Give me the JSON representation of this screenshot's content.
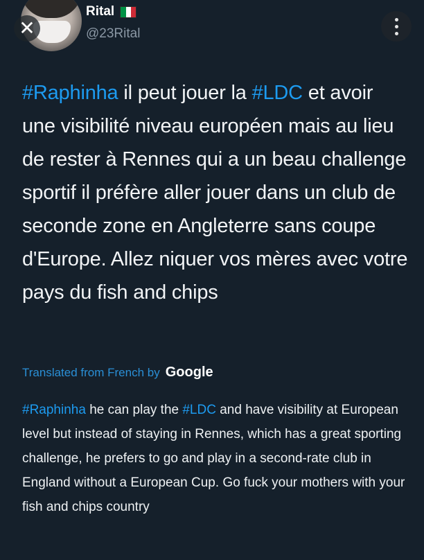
{
  "user": {
    "name": "Rital",
    "handle": "@23Rital"
  },
  "controls": {
    "close_symbol": "✕",
    "close_icon": "close-icon",
    "more_icon": "more-vertical-icon"
  },
  "colors": {
    "background": "#15202b",
    "link": "#1d9bf0",
    "flag": [
      "#009246",
      "#ffffff",
      "#ce2b37"
    ]
  },
  "tweet": {
    "tag1": "#Raphinha",
    "part1": " il peut jouer la ",
    "tag2": "#LDC",
    "part2": " et avoir une visibilité niveau européen mais au lieu de rester à Rennes qui a un beau challenge sportif il préfère aller jouer dans un club de seconde zone en Angleterre sans coupe d'Europe. Allez niquer vos mères avec votre pays du fish and chips"
  },
  "translation": {
    "label": "Translated from French by",
    "provider": "Google",
    "tag1": "#Raphinha",
    "part1": " he can play the ",
    "tag2": "#LDC",
    "part2": " and have visibility at European level but instead of staying in Rennes, which has a great sporting challenge, he prefers to go and play in a second-rate club in England without a European Cup. Go fuck your mothers with your fish and chips country"
  }
}
